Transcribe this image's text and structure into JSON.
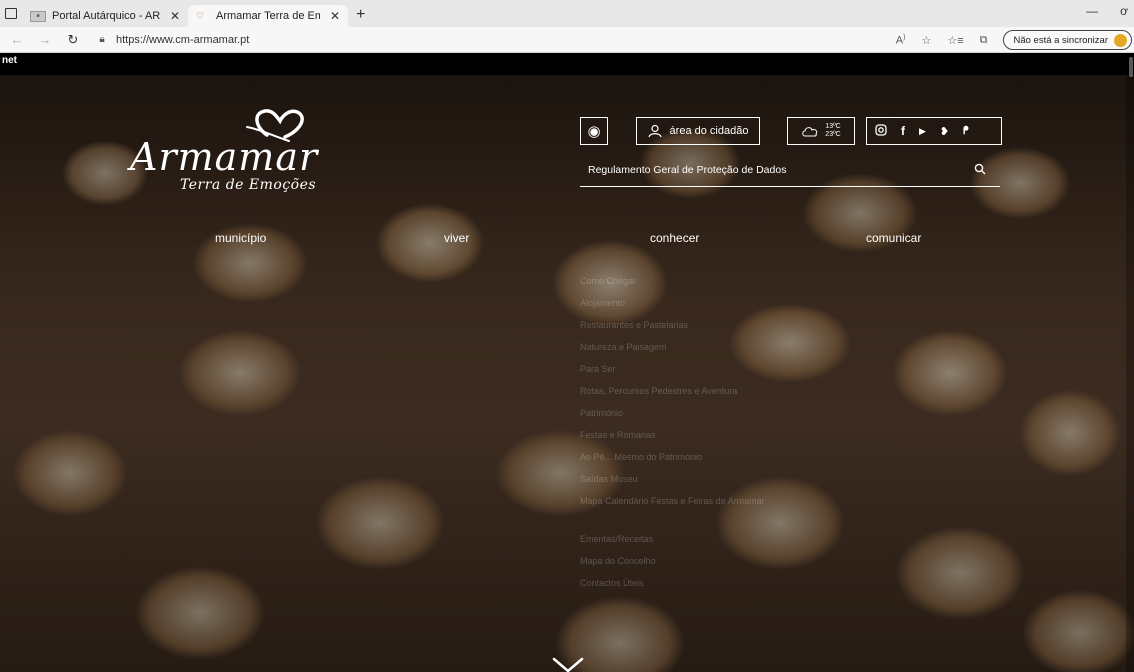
{
  "browser": {
    "tabs": [
      {
        "title": "Portal Autárquico - ARMAMAR",
        "favicon": "armamar-portal-favicon"
      },
      {
        "title": "Armamar Terra de Emoções",
        "favicon": "armamar-heart-favicon"
      }
    ],
    "url": "https://www.cm-armamar.pt",
    "sync_label": "Não está a sincronizar"
  },
  "page": {
    "top_strip_text": "net",
    "logo": {
      "wordmark": "Armamar",
      "tagline": "Terra de Emoções"
    },
    "utility": {
      "citizen_label": "área do cidadão",
      "weather_high": "13ºC",
      "weather_low": "23ºC",
      "social_icons": [
        "instagram-icon",
        "facebook-icon",
        "youtube-icon",
        "twitter-icon",
        "rss-icon"
      ]
    },
    "search": {
      "value": "Regulamento Geral de Proteção de Dados"
    },
    "nav": [
      "município",
      "viver",
      "conhecer",
      "comunicar"
    ],
    "submenu": [
      "Como Chegar",
      "Alojamento",
      "Restaurantes e Pastelarias",
      "Natureza e Paisagem",
      "Para Ser",
      "Rotas, Percursos Pedestres e Aventura",
      "Património",
      "Festas e Romarias",
      "Ao Pé... Mesmo do Património",
      "Saídas Museu",
      "Mapa Calendário Festas e Feiras de Armamar",
      "Ementas/Receitas",
      "Mapa do Concelho",
      "Contactos Úteis"
    ]
  }
}
